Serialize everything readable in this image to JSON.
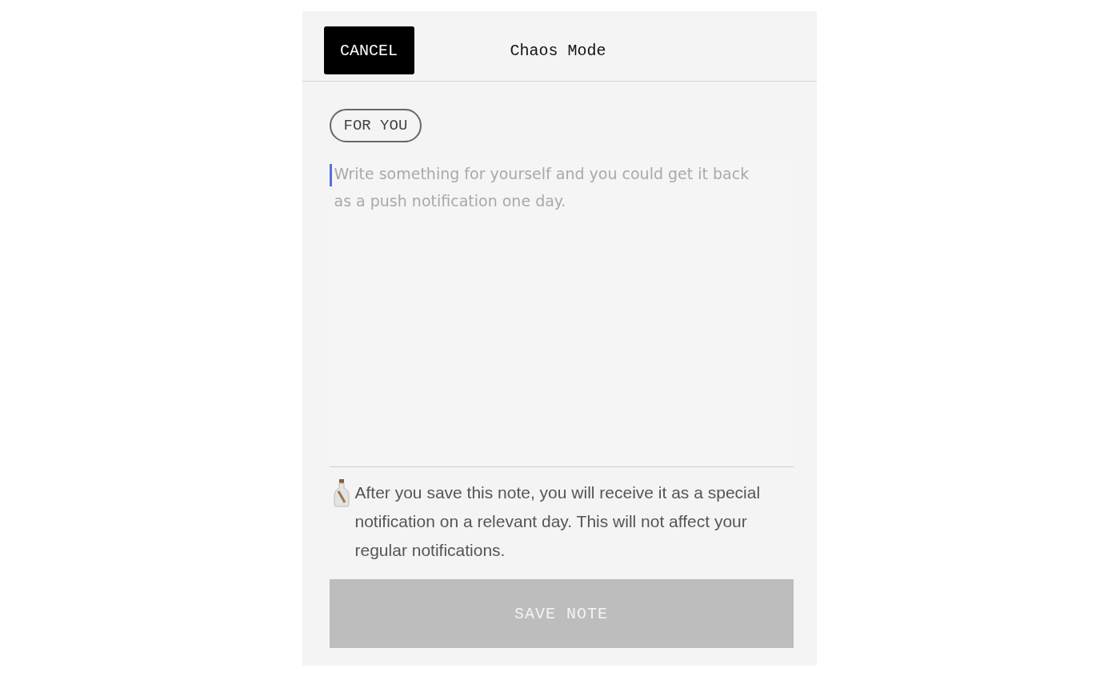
{
  "header": {
    "cancel_button": "CANCEL",
    "title": "Chaos Mode"
  },
  "tag": "FOR YOU",
  "note_field": {
    "placeholder": "Write something for yourself and you could get it back as a push notification one day.",
    "focused": true
  },
  "info": "After you save this note, you will receive it as a special notification on a relevant day. This will not affect your regular notifications.",
  "save_button": {
    "label": "SAVE NOTE",
    "disabled": true
  }
}
